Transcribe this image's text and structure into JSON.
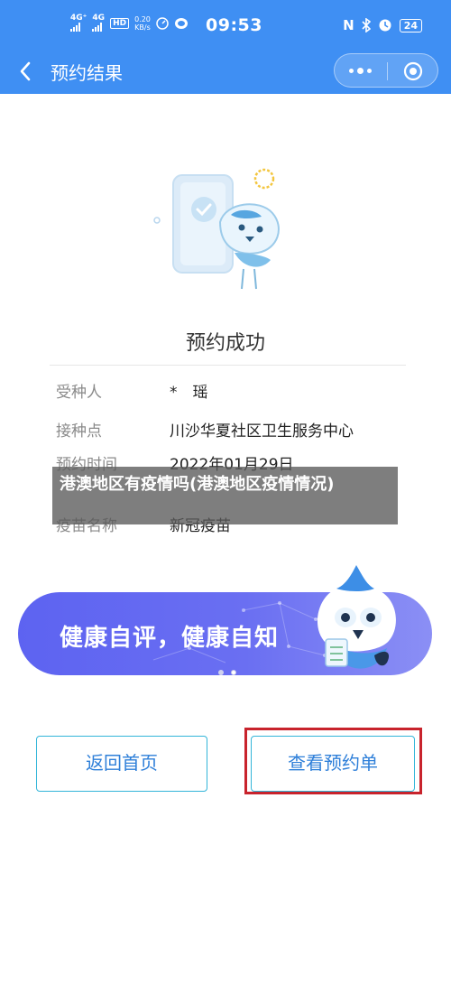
{
  "status_bar": {
    "signal1": "4G⁺",
    "signal2": "4G",
    "hd": "HD",
    "speed_value": "0.20",
    "speed_unit": "KB/s",
    "time": "09:53",
    "nfc": "N",
    "battery": "24"
  },
  "nav": {
    "title": "预约结果"
  },
  "result": {
    "title": "预约成功",
    "rows": [
      {
        "label": "受种人",
        "value": "*　瑶"
      },
      {
        "label": "接种点",
        "value": "川沙华夏社区卫生服务中心"
      },
      {
        "label": "预约时间",
        "value": "2022年01月29日"
      },
      {
        "label": "疫苗名称",
        "value": "新冠疫苗"
      }
    ]
  },
  "overlay": {
    "text": "港澳地区有疫情吗(港澳地区疫情情况)"
  },
  "banner": {
    "text": "健康自评，健康自知"
  },
  "buttons": {
    "home": "返回首页",
    "view": "查看预约单"
  },
  "colors": {
    "primary": "#3f8ff3",
    "banner": "#5d63f1",
    "button_border": "#33b5d9",
    "highlight": "#c8232c"
  }
}
